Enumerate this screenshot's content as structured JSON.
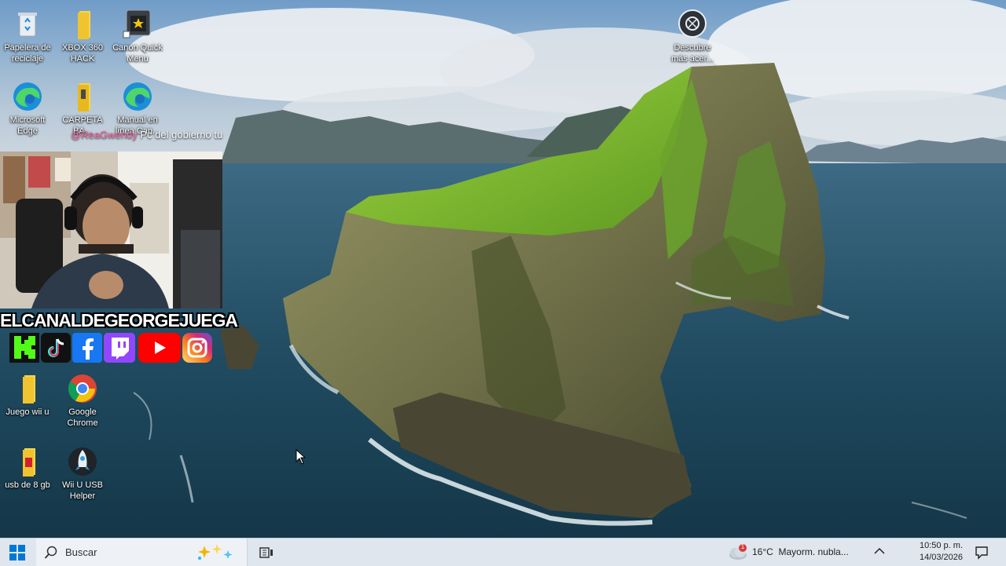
{
  "desktop": {
    "icons": [
      {
        "label": "Papelera de reciclaje",
        "icon": "recycle-bin-icon"
      },
      {
        "label": "XBOX 360 HACK",
        "icon": "folder-icon"
      },
      {
        "label": "Canon Quick Menu",
        "icon": "canon-app-icon"
      },
      {
        "label": "Microsoft Edge",
        "icon": "edge-icon"
      },
      {
        "label": "CARPETA BA...",
        "icon": "folder-icon"
      },
      {
        "label": "Manual en línea Can...",
        "icon": "edge-icon"
      },
      {
        "label": "Juego wii u",
        "icon": "folder-icon"
      },
      {
        "label": "Google Chrome",
        "icon": "chrome-icon"
      },
      {
        "label": "usb de 8 gb",
        "icon": "folder-icon"
      },
      {
        "label": "Wii U USB Helper",
        "icon": "rocket-app-icon"
      },
      {
        "label": "Descubre más acer...",
        "icon": "camera-spotlight-icon"
      }
    ]
  },
  "overlay": {
    "donor": "@ReaGwendy",
    "message": "Pc del gobierno tu",
    "channel_name": "ELCANALDEGEORGEJUEGA",
    "socials": [
      "kick-icon",
      "tiktok-icon",
      "facebook-icon",
      "twitch-icon",
      "youtube-icon",
      "instagram-icon"
    ]
  },
  "taskbar": {
    "search_placeholder": "Buscar",
    "weather": {
      "temp": "16°C",
      "condition": "Mayorm. nubla...",
      "alert_count": "1"
    },
    "time": "10:50 p. m.",
    "date": "14/03/2026"
  },
  "colors": {
    "taskbar_bg": "#dfe6ee",
    "windows_blue": "#0078d4",
    "cliff_green": "#7cb82a",
    "sea": "#1f4a5e"
  }
}
